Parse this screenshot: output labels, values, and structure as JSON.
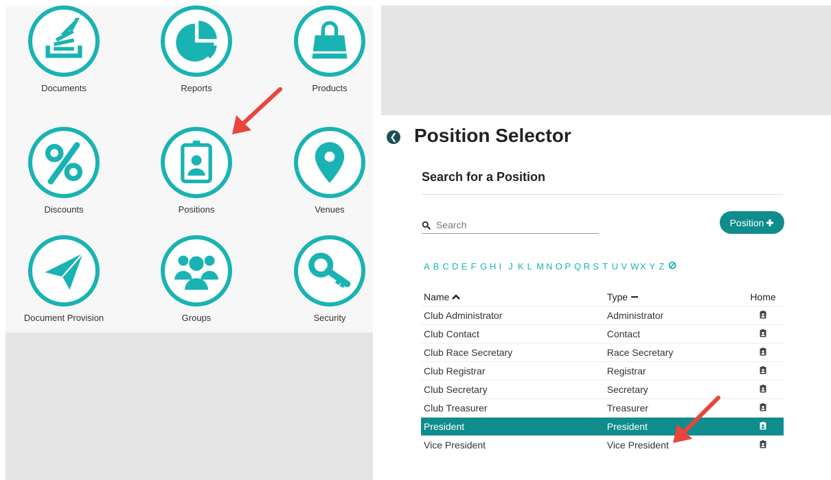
{
  "tiles": [
    {
      "label": "Documents",
      "icon": "stack-icon"
    },
    {
      "label": "Reports",
      "icon": "pie-chart-icon"
    },
    {
      "label": "Products",
      "icon": "shopping-bag-icon"
    },
    {
      "label": "Discounts",
      "icon": "percent-icon"
    },
    {
      "label": "Positions",
      "icon": "id-badge-icon"
    },
    {
      "label": "Venues",
      "icon": "map-pin-icon"
    },
    {
      "label": "Document Provision",
      "icon": "paper-plane-icon"
    },
    {
      "label": "Groups",
      "icon": "users-icon"
    },
    {
      "label": "Security",
      "icon": "key-icon"
    }
  ],
  "selector": {
    "title": "Position Selector",
    "subtitle": "Search for a Position",
    "search_placeholder": "Search",
    "add_button": "Position",
    "alphabet": [
      "A",
      "B",
      "C",
      "D",
      "E",
      "F",
      "G",
      "H",
      "I",
      "J",
      "K",
      "L",
      "M",
      "N",
      "O",
      "P",
      "Q",
      "R",
      "S",
      "T",
      "U",
      "V",
      "W",
      "X",
      "Y",
      "Z"
    ],
    "columns": {
      "name": "Name",
      "type": "Type",
      "home": "Home"
    },
    "rows": [
      {
        "name": "Club Administrator",
        "type": "Administrator"
      },
      {
        "name": "Club Contact",
        "type": "Contact"
      },
      {
        "name": "Club Race Secretary",
        "type": "Race Secretary"
      },
      {
        "name": "Club Registrar",
        "type": "Registrar"
      },
      {
        "name": "Club Secretary",
        "type": "Secretary"
      },
      {
        "name": "Club Treasurer",
        "type": "Treasurer"
      },
      {
        "name": "President",
        "type": "President",
        "selected": true
      },
      {
        "name": "Vice President",
        "type": "Vice President"
      }
    ]
  },
  "colors": {
    "accent": "#1ab3b3",
    "accent_dark": "#0f8c8c",
    "arrow": "#e8453c"
  }
}
